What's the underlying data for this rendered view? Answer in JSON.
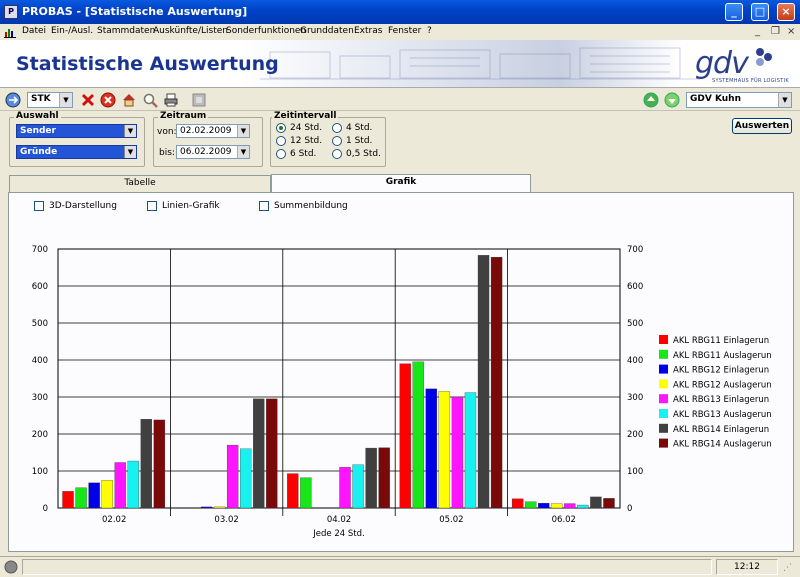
{
  "window": {
    "title": "PROBAS - [Statistische Auswertung]"
  },
  "menu": [
    "Datei",
    "Ein-/Ausl.",
    "Stammdaten",
    "Auskünfte/Listen",
    "Sonderfunktionen",
    "Grunddaten",
    "Extras",
    "Fenster",
    "?"
  ],
  "banner": {
    "title": "Statistische Auswertung",
    "logo": "gdv",
    "logo_sub": "SYSTEMHAUS FÜR LOGISTIK"
  },
  "toolbar": {
    "unit_value": "STK",
    "user_value": "GDV Kuhn"
  },
  "filters": {
    "auswahl_label": "Auswahl",
    "auswahl_1": "Sender",
    "auswahl_2": "Gründe",
    "zeitraum_label": "Zeitraum",
    "von_label": "von:",
    "von_value": "02.02.2009",
    "bis_label": "bis:",
    "bis_value": "06.02.2009",
    "zeitintervall_label": "Zeitintervall",
    "intervals": [
      "24 Std.",
      "4 Std.",
      "12 Std.",
      "1 Std.",
      "6 Std.",
      "0,5 Std."
    ],
    "selected_interval": "24 Std.",
    "auswerten_label": "Auswerten"
  },
  "tabs": {
    "table_label": "Tabelle",
    "graph_label": "Grafik",
    "active": "Grafik"
  },
  "options": {
    "opt_3d": "3D-Darstellung",
    "opt_line": "Linien-Grafik",
    "opt_sum": "Summenbildung"
  },
  "chart_data": {
    "type": "bar",
    "xlabel": "Jede 24 Std.",
    "ylim": [
      0,
      700
    ],
    "yticks": [
      0,
      100,
      200,
      300,
      400,
      500,
      600,
      700
    ],
    "categories": [
      "02.02",
      "03.02",
      "04.02",
      "05.02",
      "06.02"
    ],
    "legend_position": "right",
    "grid": true,
    "series": [
      {
        "name": "AKL RBG11 Einlagerun",
        "color": "#ff0000",
        "values": [
          45,
          0,
          93,
          390,
          25
        ]
      },
      {
        "name": "AKL RBG11 Auslagerun",
        "color": "#19e619",
        "values": [
          55,
          0,
          82,
          395,
          17
        ]
      },
      {
        "name": "AKL RBG12 Einlagerun",
        "color": "#0000e6",
        "values": [
          68,
          3,
          0,
          322,
          13
        ]
      },
      {
        "name": "AKL RBG12 Auslagerun",
        "color": "#ffff00",
        "values": [
          75,
          3,
          0,
          315,
          12
        ]
      },
      {
        "name": "AKL RBG13 Einlagerun",
        "color": "#ff14ff",
        "values": [
          123,
          170,
          110,
          300,
          12
        ]
      },
      {
        "name": "AKL RBG13 Auslagerun",
        "color": "#19f0f0",
        "values": [
          127,
          160,
          117,
          312,
          8
        ]
      },
      {
        "name": "AKL RBG14 Einlagerun",
        "color": "#404040",
        "values": [
          240,
          295,
          162,
          683,
          30
        ]
      },
      {
        "name": "AKL RBG14 Auslagerun",
        "color": "#7a0a0a",
        "values": [
          238,
          295,
          163,
          678,
          26
        ]
      }
    ]
  },
  "status": {
    "time": "12:12"
  }
}
